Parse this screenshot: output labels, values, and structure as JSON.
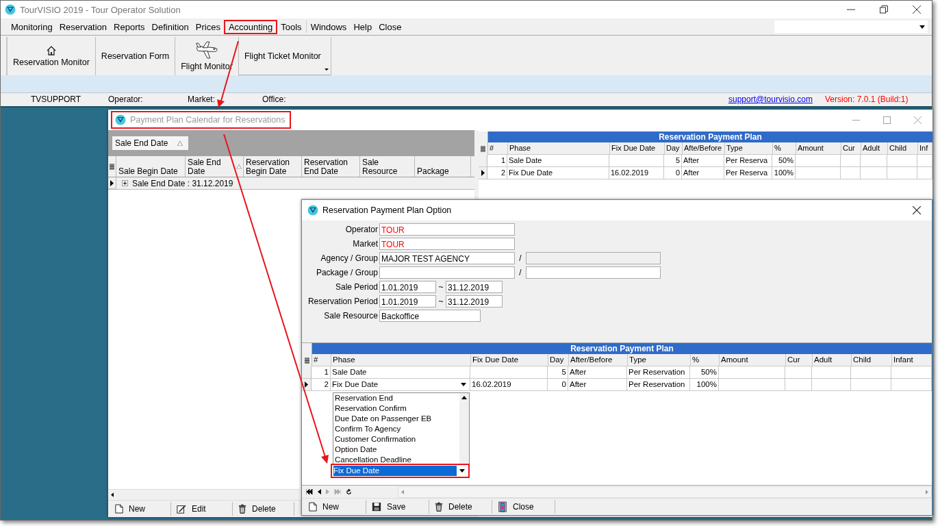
{
  "app": {
    "title": "TourVISIO 2019 - Tour Operator Solution"
  },
  "menu": [
    {
      "label": "Monitoring",
      "highlighted": false
    },
    {
      "label": "Reservation",
      "highlighted": false
    },
    {
      "label": "Reports",
      "highlighted": false
    },
    {
      "label": "Definition",
      "highlighted": false
    },
    {
      "label": "Prices",
      "highlighted": false
    },
    {
      "label": "Accounting",
      "highlighted": true
    },
    {
      "label": "Tools",
      "highlighted": false
    },
    {
      "label": "Windows",
      "highlighted": false
    },
    {
      "label": "Help",
      "highlighted": false
    },
    {
      "label": "Close",
      "highlighted": false
    }
  ],
  "toolbar": [
    {
      "label": "Reservation Monitor",
      "kind": "house"
    },
    {
      "label": "Reservation Form",
      "kind": "text"
    },
    {
      "label": "Flight Monitor",
      "kind": "plane"
    },
    {
      "label": "Flight Ticket Monitor",
      "kind": "menu"
    }
  ],
  "status_bar": {
    "user": "TVSUPPORT",
    "operator": "Operator:",
    "market": "Market:",
    "office": "Office:",
    "email": "support@tourvisio.com",
    "version": "Version: 7.0.1 (Build:1)"
  },
  "calendar_window": {
    "title": "Payment Plan Calendar for Reservations",
    "highlighted": true,
    "group_by": "Sale End Date",
    "columns": [
      "Sale Begin Date",
      "Sale End Date",
      "Reservation Begin Date",
      "Reservation End Date",
      "Sale Resource",
      "Package"
    ],
    "group_row": "Sale End Date : 31.12.2019",
    "buttons": [
      {
        "label": "New",
        "kind": "page"
      },
      {
        "label": "Edit",
        "kind": "edit"
      },
      {
        "label": "Delete",
        "kind": "trash"
      }
    ],
    "plan": {
      "title": "Reservation Payment Plan",
      "columns": [
        "#",
        "Phase",
        "Fix Due Date",
        "Day",
        "Afte/Before",
        "Type",
        "%",
        "Amount",
        "Cur",
        "Adult",
        "Child",
        "Inf"
      ],
      "rows": [
        {
          "current": false,
          "cells": [
            "1",
            "Sale Date",
            null,
            "5",
            "After",
            "Per Reserva",
            "50%",
            null,
            null,
            null,
            null,
            null
          ]
        },
        {
          "current": true,
          "cells": [
            "2",
            "Fix Due Date",
            "16.02.2019",
            "0",
            "After",
            "Per Reserva",
            "100%",
            null,
            null,
            null,
            null,
            null
          ]
        }
      ]
    }
  },
  "dialog": {
    "title": "Reservation Payment Plan Option",
    "fields": [
      {
        "label": "Operator",
        "kind": "single",
        "inputs": [
          {
            "value": "TOUR",
            "color": "#ff0000",
            "disabled": false
          }
        ]
      },
      {
        "label": "Market",
        "kind": "single",
        "inputs": [
          {
            "value": "TOUR",
            "color": "#ff0000",
            "disabled": false
          }
        ]
      },
      {
        "label": "Agency / Group",
        "kind": "pair",
        "separator": "/",
        "inputs": [
          {
            "value": "MAJOR TEST AGENCY",
            "color": "#000000",
            "disabled": false
          },
          {
            "disabled": true
          }
        ]
      },
      {
        "label": "Package / Group",
        "kind": "pair",
        "separator": "/",
        "inputs": [
          {
            "disabled": false
          },
          {
            "disabled": false
          }
        ]
      },
      {
        "label": "Sale Period",
        "kind": "range",
        "separator": "~",
        "inputs": [
          {
            "value": "1.01.2019",
            "color": "#000000",
            "disabled": false
          },
          {
            "value": "31.12.2019",
            "color": "#000000",
            "disabled": false
          }
        ]
      },
      {
        "label": "Reservation Period",
        "kind": "range",
        "separator": "~",
        "inputs": [
          {
            "value": "1.01.2019",
            "color": "#000000",
            "disabled": false
          },
          {
            "value": "31.12.2019",
            "color": "#000000",
            "disabled": false
          }
        ]
      },
      {
        "label": "Sale Resource",
        "kind": "short",
        "inputs": [
          {
            "value": "Backoffice",
            "color": "#000000",
            "disabled": false
          }
        ]
      }
    ],
    "plan": {
      "title": "Reservation Payment Plan",
      "columns": [
        "#",
        "Phase",
        "Fix Due Date",
        "Day",
        "After/Before",
        "Type",
        "%",
        "Amount",
        "Cur",
        "Adult",
        "Child",
        "Infant"
      ],
      "rows": [
        {
          "current": false,
          "editing": false,
          "cells": [
            "1",
            "Sale Date",
            null,
            "5",
            "After",
            "Per Reservation",
            "50%",
            null,
            null,
            null,
            null,
            null
          ]
        },
        {
          "current": true,
          "editing": true,
          "cells": [
            "2",
            "Fix Due Date",
            "16.02.2019",
            "0",
            "After",
            "Per Reservation",
            "100%",
            null,
            null,
            null,
            null,
            null
          ]
        }
      ]
    },
    "dropdown": {
      "options": [
        "Reservation End",
        "Reservation Confirm",
        "Due Date on Passenger EB",
        "Confirm To Agency",
        "Customer Confirmation",
        "Option Date",
        "Cancellation Deadline"
      ],
      "value": "Fix Due Date",
      "highlighted": true
    },
    "buttons": [
      {
        "label": "New",
        "kind": "page"
      },
      {
        "label": "Save",
        "kind": "floppy"
      },
      {
        "label": "Delete",
        "kind": "trash"
      },
      {
        "label": "Close",
        "kind": "door"
      }
    ]
  }
}
